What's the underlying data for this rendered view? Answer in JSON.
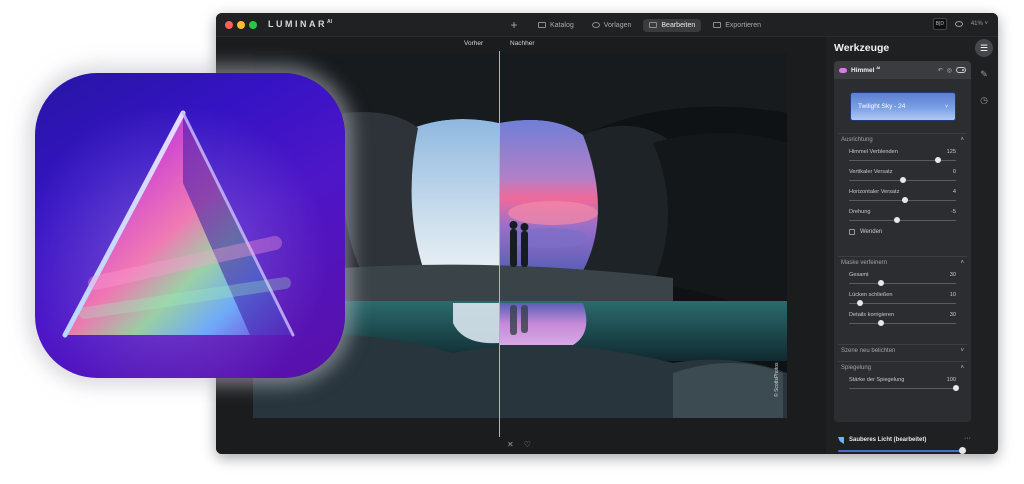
{
  "app": {
    "brand": "LUMINAR",
    "brand_suffix": "AI",
    "nav": [
      {
        "label": "Katalog",
        "active": false
      },
      {
        "label": "Vorlagen",
        "active": false
      },
      {
        "label": "Bearbeiten",
        "active": true
      },
      {
        "label": "Exportieren",
        "active": false
      }
    ],
    "zoom": "41%",
    "compare_label": "B|D"
  },
  "canvas": {
    "before_label": "Vorher",
    "after_label": "Nachher",
    "copyright": "© ScottsPhotos"
  },
  "panel": {
    "title": "Werkzeuge",
    "tool_name": "Himmel",
    "tool_suffix": "AI",
    "sky_selection": "Twilight Sky - 24",
    "sections": [
      {
        "title": "Ausrichtung",
        "sliders": [
          {
            "label": "Himmel Verblenden",
            "value": "125",
            "fraction": 0.83
          },
          {
            "label": "Vertikaler Versatz",
            "value": "0",
            "fraction": 0.5
          },
          {
            "label": "Horizontaler Versatz",
            "value": "4",
            "fraction": 0.52
          },
          {
            "label": "Drehung",
            "value": "-5",
            "fraction": 0.45
          }
        ],
        "checkbox": "Wenden"
      },
      {
        "title": "Maske verfeinern",
        "sliders": [
          {
            "label": "Gesamt",
            "value": "30",
            "fraction": 0.3
          },
          {
            "label": "Lücken schließen",
            "value": "10",
            "fraction": 0.1
          },
          {
            "label": "Details korrigieren",
            "value": "30",
            "fraction": 0.3
          }
        ]
      },
      {
        "title": "Szene neu belichten"
      },
      {
        "title": "Spiegelung",
        "sliders": [
          {
            "label": "Stärke der Spiegelung",
            "value": "100",
            "fraction": 1.0
          }
        ]
      }
    ],
    "footer_tool": "Sauberes Licht (bearbeitet)",
    "footer_fraction": 0.98
  },
  "colors": {
    "accent": "#6ec7ff",
    "tool_icon": "#d57be6"
  },
  "icons": {
    "logo": "luminar-ai-app-icon",
    "tools": "sliders-icon",
    "brush": "brush-icon",
    "history": "clock-icon"
  }
}
